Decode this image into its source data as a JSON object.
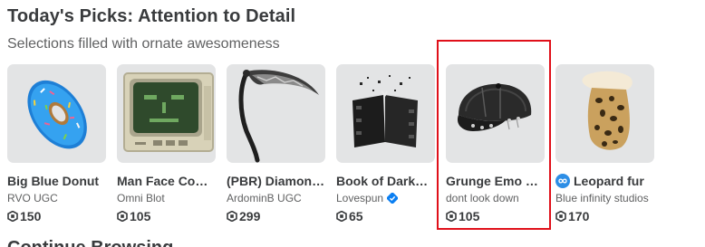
{
  "section": {
    "title": "Today's Picks: Attention to Detail",
    "subtitle": "Selections filled with ornate awesomeness"
  },
  "items": [
    {
      "name": "Big Blue Donut",
      "creator": "RVO UGC",
      "price": "150",
      "thumbnail_icon": "blue-donut-icon"
    },
    {
      "name": "Man Face Computer",
      "creator": "Omni Blot",
      "price": "105",
      "thumbnail_icon": "retro-computer-icon"
    },
    {
      "name": "(PBR) Diamond Scythe",
      "creator": "ArdominB UGC",
      "price": "299",
      "thumbnail_icon": "scythe-icon"
    },
    {
      "name": "Book of Darkness",
      "creator": "Lovespun",
      "creator_verified": true,
      "price": "65",
      "thumbnail_icon": "dark-book-icon"
    },
    {
      "name": "Grunge Emo Punk Cap",
      "creator": "dont look down",
      "price": "105",
      "thumbnail_icon": "grunge-cap-icon",
      "highlighted": true
    },
    {
      "name": "Leopard fur",
      "creator": "Blue infinity studios",
      "price": "170",
      "thumbnail_icon": "leopard-fur-icon",
      "name_badge": "infinity-badge-icon"
    }
  ],
  "next_section": {
    "title": "Continue Browsing"
  },
  "colors": {
    "text_primary": "#393b3d",
    "text_secondary": "#606162",
    "thumbnail_bg": "#e3e4e5",
    "highlight_border": "#e0101a",
    "verified_blue": "#0b7ff2"
  },
  "icons": {
    "currency": "robux-icon",
    "verified": "verified-badge-icon"
  }
}
